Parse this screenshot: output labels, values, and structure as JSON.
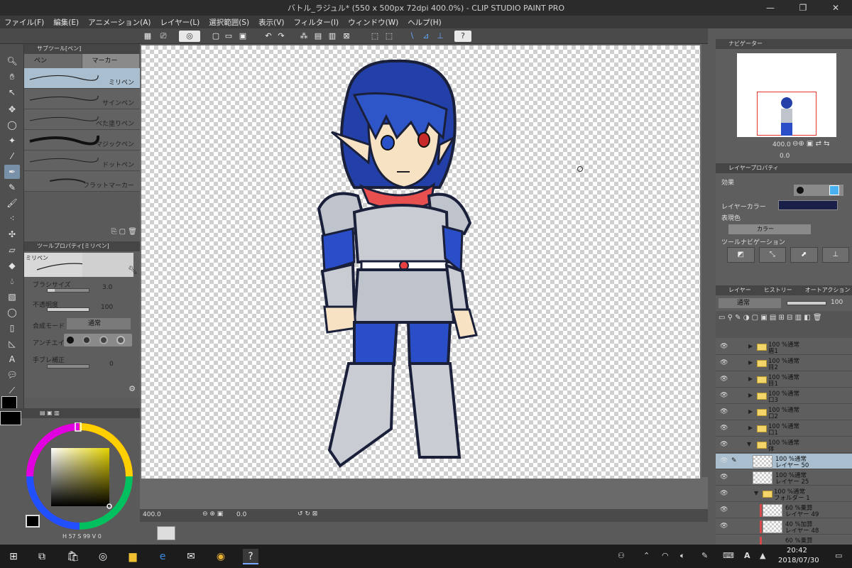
{
  "window": {
    "title": "バトル_ラジュル* (550 x 500px 72dpi 400.0%)  - CLIP STUDIO PAINT PRO"
  },
  "menu": [
    "ファイル(F)",
    "編集(E)",
    "アニメーション(A)",
    "レイヤー(L)",
    "選択範囲(S)",
    "表示(V)",
    "フィルター(I)",
    "ウィンドウ(W)",
    "ヘルプ(H)"
  ],
  "subtool": {
    "header": "サブツール[ペン]",
    "tabs": [
      "ペン",
      "マーカー"
    ],
    "brushes": [
      "ミリペン",
      "サインペン",
      "べた塗りペン",
      "マジックペン",
      "ドットペン",
      "フラットマーカー"
    ],
    "selected": "ミリペン"
  },
  "toolprop": {
    "header": "ツールプロパティ[ミリペン]",
    "preview_label": "ミリペン",
    "brush_size_label": "ブラシサイズ",
    "brush_size_value": "3.0",
    "opacity_label": "不透明度",
    "opacity_value": "100",
    "blend_label": "合成モード",
    "blend_value": "通常",
    "antialias_label": "アンチエイリアス",
    "stabilization_label": "手ブレ補正",
    "stabilization_value": "0"
  },
  "color": {
    "main": "#000000",
    "readout": [
      "H",
      "57",
      "S",
      "99",
      "V",
      "0"
    ]
  },
  "canvas": {
    "zoom": "400.0",
    "angle": "0.0"
  },
  "navigator": {
    "tab": "ナビゲーター",
    "zoom": "400.0",
    "angle": "0.0"
  },
  "layerprop": {
    "tab": "レイヤープロパティ",
    "effect_label": "効果",
    "layer_color_label": "レイヤーカラー",
    "expression_label": "表現色",
    "expression_value": "カラー",
    "toolnav_label": "ツールナビゲーション"
  },
  "layers": {
    "tabs": [
      "レイヤー",
      "ヒストリー",
      "オートアクション"
    ],
    "blend": "通常",
    "opacity": "100",
    "rows": [
      {
        "mode": "100 %通常",
        "name": "眉1"
      },
      {
        "mode": "100 %通常",
        "name": "目2"
      },
      {
        "mode": "100 %通常",
        "name": "目1"
      },
      {
        "mode": "100 %通常",
        "name": "口3"
      },
      {
        "mode": "100 %通常",
        "name": "口2"
      },
      {
        "mode": "100 %通常",
        "name": "口1"
      },
      {
        "mode": "100 %通常",
        "name": "体"
      },
      {
        "mode": "100 %通常",
        "name": "レイヤー 50"
      },
      {
        "mode": "100 %通常",
        "name": "レイヤー 25"
      },
      {
        "mode": "100 %通常",
        "name": "フォルダー 1"
      },
      {
        "mode": "60 %乗算",
        "name": "レイヤー 49"
      },
      {
        "mode": "40 %加算",
        "name": "レイヤー 48"
      },
      {
        "mode": "60 %乗算",
        "name": ""
      }
    ]
  },
  "taskbar": {
    "time": "20:42",
    "date": "2018/07/30"
  }
}
